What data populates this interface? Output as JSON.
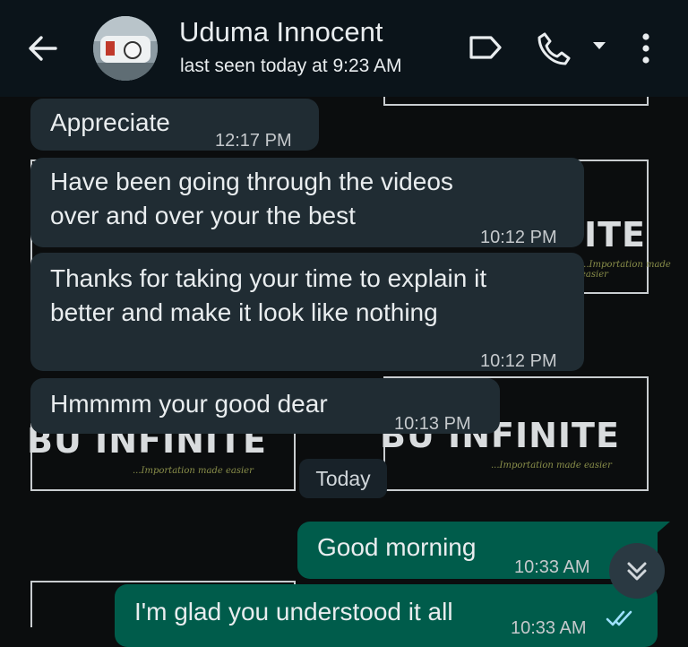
{
  "header": {
    "contact_name": "Uduma Innocent",
    "last_seen": "last seen today at 9:23 AM",
    "icons": [
      "back-arrow-icon",
      "label-tag-icon",
      "phone-call-icon",
      "dropdown-caret-icon",
      "more-vert-icon"
    ]
  },
  "wallpaper": {
    "logo_texts": [
      "ITE",
      "BU  INFINITE",
      "BU  INFINITE"
    ],
    "taglines": [
      "...Importation made easier",
      "...Importation made easier",
      "...Importation made easier"
    ]
  },
  "messages": [
    {
      "text": "Appreciate",
      "time": "12:17 PM",
      "direction": "incoming"
    },
    {
      "text": "Have been going through the videos over and over your the best",
      "line1": "Have been going through the videos",
      "line2": "over and over your the best",
      "time": "10:12 PM",
      "direction": "incoming"
    },
    {
      "text": "Thanks for taking your time to explain it better and make it look like nothing",
      "line1": "Thanks for taking your time to explain it",
      "line2": "better and make it look like nothing",
      "time": "10:12 PM",
      "direction": "incoming"
    },
    {
      "text": "Hmmmm your good dear",
      "time": "10:13 PM",
      "direction": "incoming"
    },
    {
      "text": "Good morning",
      "time": "10:33 AM",
      "direction": "outgoing"
    },
    {
      "text": "I'm glad you understood it all",
      "time": "10:33 AM",
      "direction": "outgoing",
      "status": "read"
    }
  ],
  "date_divider": "Today",
  "colors": {
    "header_bg": "#0b141a",
    "incoming_bubble": "#202c33",
    "outgoing_bubble": "#005c4b",
    "read_tick": "#9de1fe"
  }
}
